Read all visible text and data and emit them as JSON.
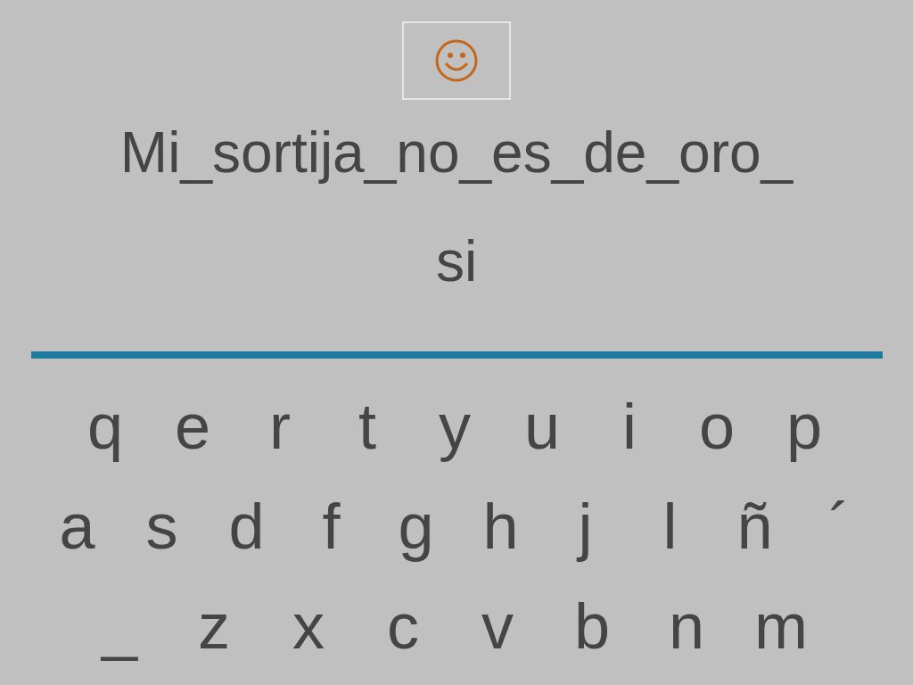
{
  "phrase": "Mi_sortija_no_es_de_oro_",
  "answer": "si",
  "keyboard": [
    [
      "q",
      "e",
      "r",
      "t",
      "y",
      "u",
      "i",
      "o",
      "p"
    ],
    [
      "a",
      "s",
      "d",
      "f",
      "g",
      "h",
      "j",
      "l",
      "ñ",
      "´"
    ],
    [
      "_",
      "z",
      "x",
      "c",
      "v",
      "b",
      "n",
      "m"
    ]
  ]
}
